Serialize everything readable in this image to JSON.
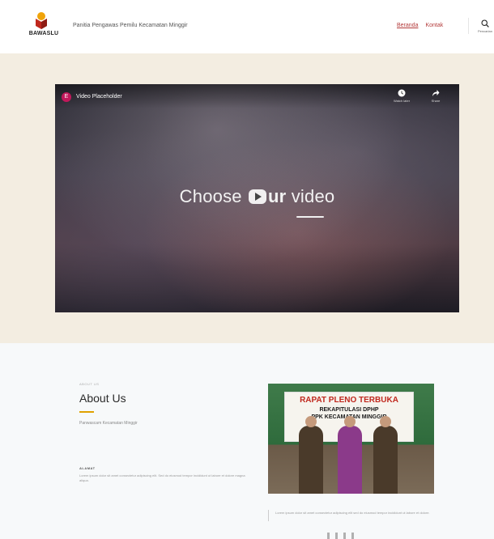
{
  "header": {
    "logo_text": "BAWASLU",
    "site_title": "Panitia Pengawas Pemilu Kecamatan Minggir",
    "nav": [
      {
        "label": "Beranda"
      },
      {
        "label": "Kontak"
      }
    ],
    "search_label": "Pencarian"
  },
  "video": {
    "badge": "E",
    "title": "Video Placeholder",
    "actions": [
      {
        "label": "Watch later",
        "icon": "clock-icon"
      },
      {
        "label": "Share",
        "icon": "share-icon"
      }
    ],
    "center_text_before": "Choose ",
    "center_text_bold": "ur",
    "center_text_after": " video"
  },
  "about": {
    "eyebrow": "ABOUT US",
    "title": "About Us",
    "subtitle": "Panwascam Kecamatan Minggir",
    "label": "ALAMAT",
    "body": "Lorem ipsum dolor sit amet consectetur adipiscing elit. Sed do eiusmod tempor incididunt ut labore et dolore magna aliqua.",
    "photo": {
      "banner_title": "RAPAT PLENO TERBUKA",
      "banner_line1": "REKAPITULASI DPHP",
      "banner_line2": "PPK KECAMATAN MINGGIR"
    },
    "caption": "Lorem ipsum dolor sit amet consectetur adipiscing elit sed do eiusmod tempor incididunt ut labore et dolore."
  },
  "colors": {
    "accent": "#b33a3a",
    "hero_bg": "#f3ede1",
    "accent_line": "#e0a100"
  }
}
